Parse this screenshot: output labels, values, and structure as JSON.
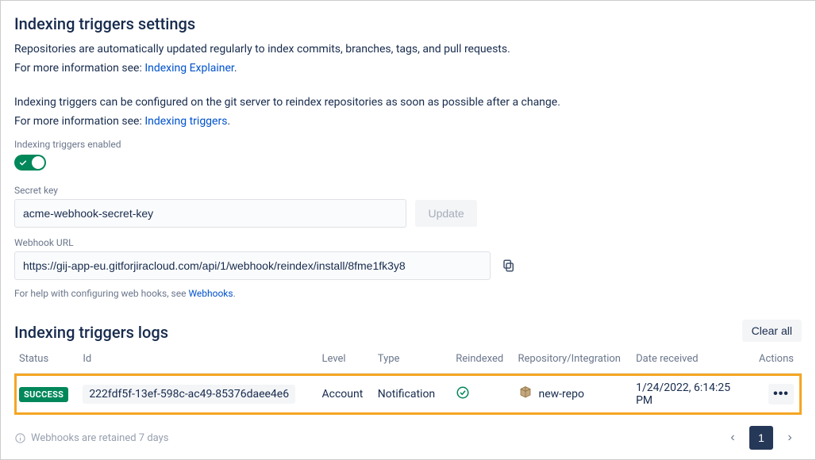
{
  "settings": {
    "title": "Indexing triggers settings",
    "intro1a": "Repositories are automatically updated regularly to index commits, branches, tags, and pull requests.",
    "intro1b_prefix": "For more information see: ",
    "intro1b_link": "Indexing Explainer",
    "intro2a": "Indexing triggers can be configured on the git server to reindex repositories as soon as possible after a change.",
    "intro2b_prefix": "For more information see: ",
    "intro2b_link": "Indexing triggers",
    "toggle_label": "Indexing triggers enabled",
    "secret_key_label": "Secret key",
    "secret_key_value": "acme-webhook-secret-key",
    "update_button": "Update",
    "webhook_label": "Webhook URL",
    "webhook_value": "https://gij-app-eu.gitforjiracloud.com/api/1/webhook/reindex/install/8fme1fk3y8",
    "help_prefix": "For help with configuring web hooks, see ",
    "help_link": "Webhooks",
    "help_suffix": "."
  },
  "logs": {
    "title": "Indexing triggers logs",
    "clear_all": "Clear all",
    "columns": {
      "status": "Status",
      "id": "Id",
      "level": "Level",
      "type": "Type",
      "reindexed": "Reindexed",
      "repo": "Repository/Integration",
      "date": "Date received",
      "actions": "Actions"
    },
    "rows": [
      {
        "status": "SUCCESS",
        "id": "222fdf5f-13ef-598c-ac49-85376daee4e6",
        "level": "Account",
        "type": "Notification",
        "repo": "new-repo",
        "date": "1/24/2022, 6:14:25 PM"
      }
    ],
    "retention": "Webhooks are retained 7 days",
    "pager_current": "1"
  }
}
